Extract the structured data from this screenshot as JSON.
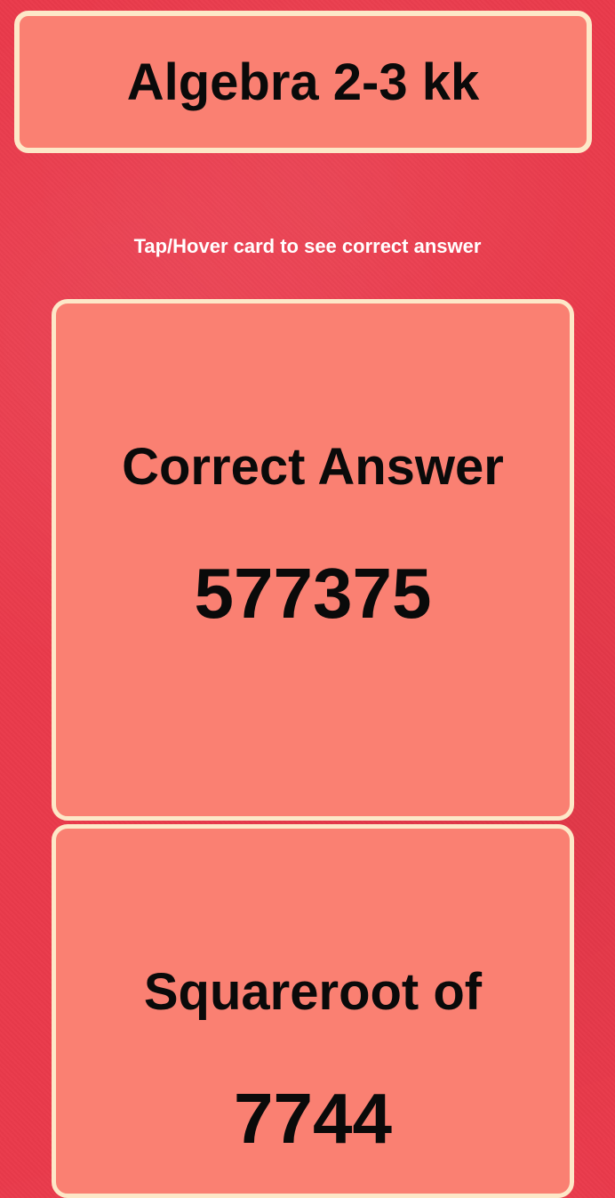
{
  "header": {
    "title": "Algebra 2-3 kk"
  },
  "instructions": {
    "text": "Tap/Hover card to see correct answer"
  },
  "cards": [
    {
      "heading": "Correct Answer",
      "value": "577375"
    },
    {
      "heading": "Squareroot of",
      "value": "7744"
    }
  ],
  "colors": {
    "background": "#ea3a4b",
    "card_fill": "#fa8072",
    "card_border": "#fde8c8",
    "text": "#0a0a0a",
    "hint_text": "#ffffff"
  }
}
